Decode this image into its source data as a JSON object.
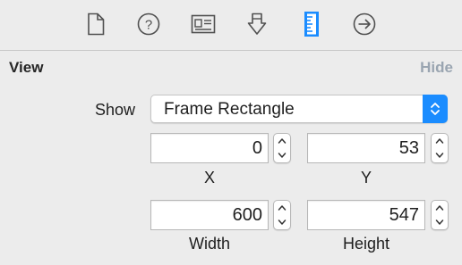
{
  "toolbar": {
    "tabs": [
      {
        "icon": "file-icon"
      },
      {
        "icon": "help-icon"
      },
      {
        "icon": "identity-icon"
      },
      {
        "icon": "attributes-icon"
      },
      {
        "icon": "ruler-icon",
        "selected": true
      },
      {
        "icon": "connections-icon"
      }
    ]
  },
  "section": {
    "title": "View",
    "hide_label": "Hide"
  },
  "show": {
    "label": "Show",
    "value": "Frame Rectangle"
  },
  "fields": {
    "x": {
      "value": "0",
      "label": "X"
    },
    "y": {
      "value": "53",
      "label": "Y"
    },
    "width": {
      "value": "600",
      "label": "Width"
    },
    "height": {
      "value": "547",
      "label": "Height"
    }
  },
  "colors": {
    "accent": "#1a8cff",
    "hide_text": "#9aa5b1",
    "background": "#ececec"
  }
}
